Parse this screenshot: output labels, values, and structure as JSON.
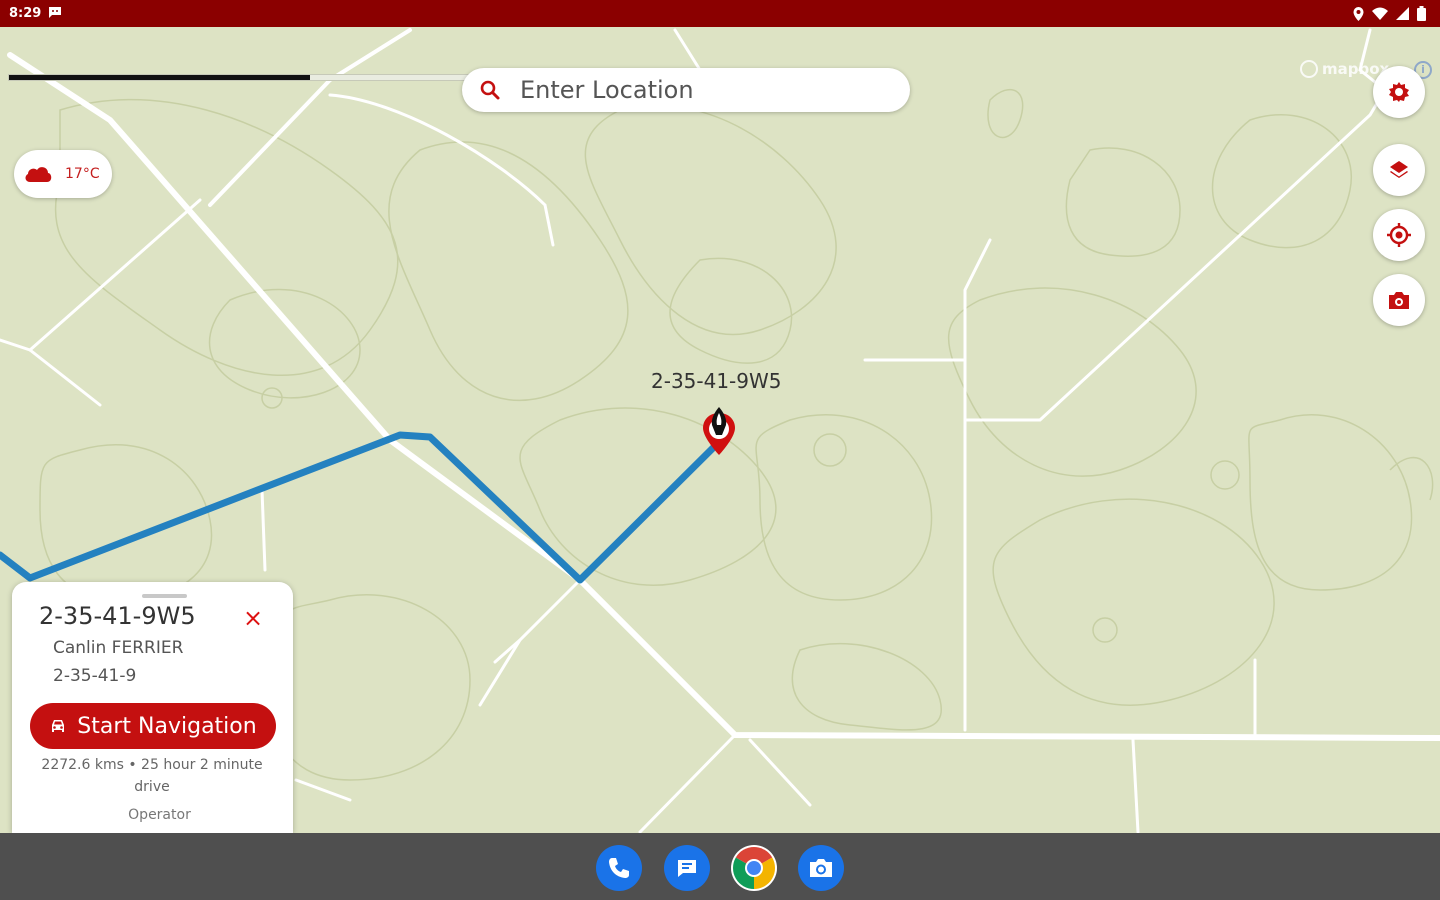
{
  "status_bar": {
    "time": "8:29",
    "icons": [
      "message-icon",
      "location-icon",
      "wifi-icon",
      "signal-icon",
      "battery-icon"
    ]
  },
  "map": {
    "progress": 0.5,
    "attribution": "mapbox",
    "info_label": "i",
    "pin_label": "2-35-41-9W5",
    "colors": {
      "land": "#dde3c4",
      "route": "#2481c0",
      "road": "#ffffff",
      "contour": "#c7cfa4"
    }
  },
  "search": {
    "placeholder": "Enter Location",
    "icon": "search-icon"
  },
  "weather": {
    "temperature": "17°C",
    "icon": "cloud-icon"
  },
  "fabs": [
    "gear-icon",
    "layers-icon",
    "my-location-icon",
    "camera-icon"
  ],
  "location_card": {
    "title": "2-35-41-9W5",
    "close_label": "×",
    "operator_name": "Canlin FERRIER",
    "location_code": "2-35-41-9",
    "nav_button_label": "Start Navigation",
    "trip_info": "2272.6 kms  • 25 hour 2 minute drive",
    "footer_label": "Operator"
  },
  "dock": {
    "apps": [
      "phone-icon",
      "messages-icon",
      "chrome-icon",
      "camera-app-icon"
    ]
  },
  "accent_color": "#c41010"
}
